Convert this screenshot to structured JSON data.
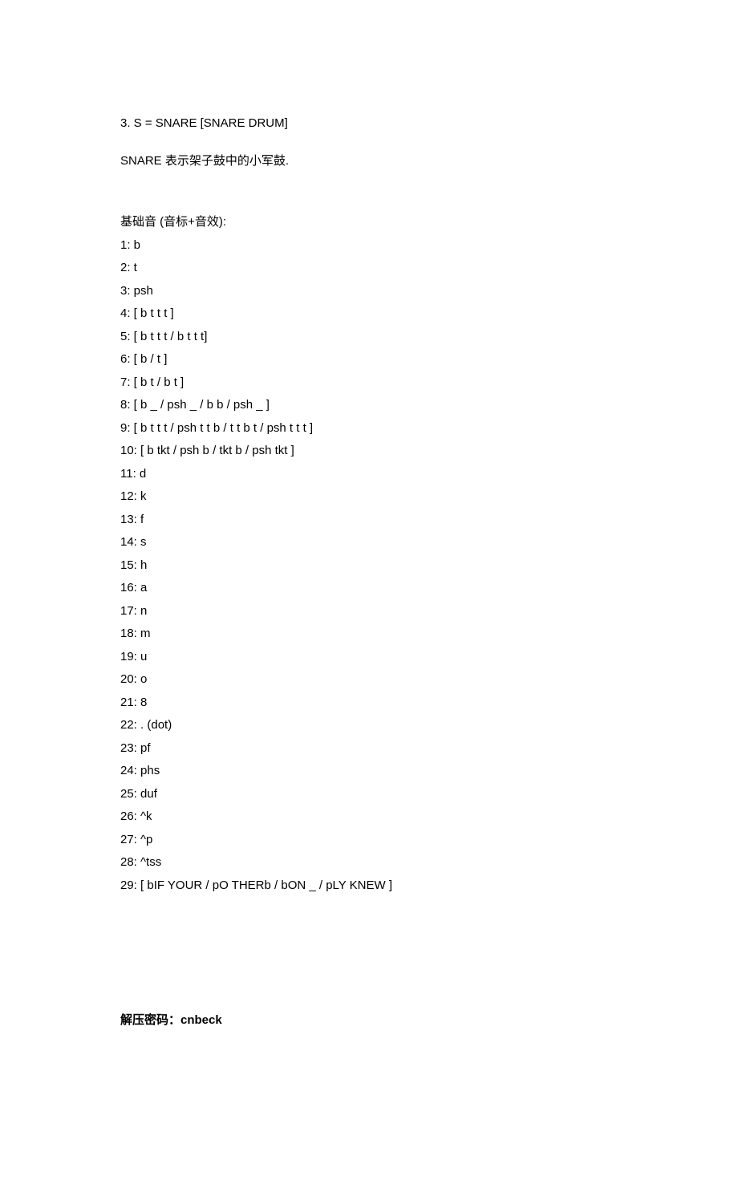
{
  "section": {
    "title": "3. S = SNARE [SNARE DRUM]",
    "desc": "SNARE 表示架子鼓中的小军鼓."
  },
  "items": {
    "heading": "基础音  (音标+音效):",
    "list": [
      "1: b",
      "2: t",
      "3: psh",
      "4: [ b t t t ]",
      "5: [ b t t t / b t t t]",
      "6: [ b / t ]",
      "7: [ b t / b t ]",
      "8: [ b _ / psh _ / b b / psh _ ]",
      "9: [ b t t t / psh t t b / t t b t / psh t t t ]",
      "10: [ b tkt / psh b / tkt b / psh tkt ]",
      "11: d",
      "12: k",
      "13: f",
      "14: s",
      "15: h",
      "16: a",
      "17: n",
      "18: m",
      "19: u",
      "20: o",
      "21: 8",
      "22: . (dot)",
      "23: pf",
      "24: phs",
      "25: duf",
      "26: ^k",
      "27: ^p",
      "28: ^tss",
      "29: [ bIF YOUR / pO THERb / bON _ / pLY KNEW ]"
    ]
  },
  "footer": {
    "label": "解压密码：",
    "value": "cnbeck"
  }
}
